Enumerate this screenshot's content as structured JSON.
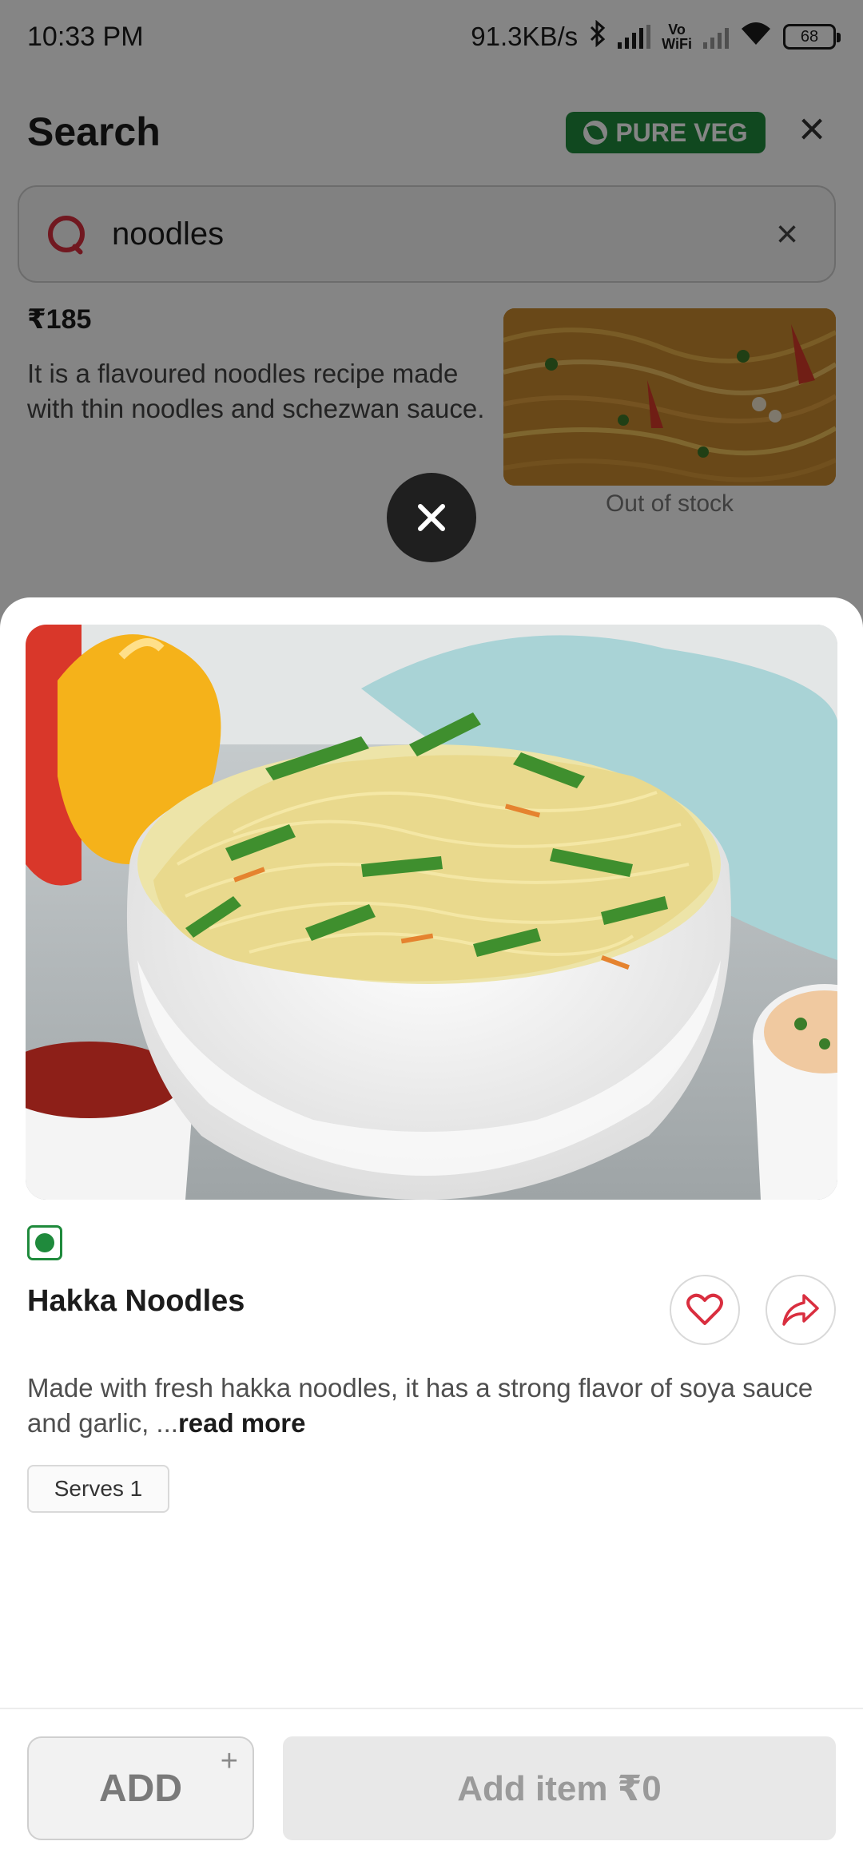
{
  "status_bar": {
    "time": "10:33 PM",
    "network_speed": "91.3KB/s",
    "vowifi_top": "Vo",
    "vowifi_bottom": "WiFi",
    "battery": "68"
  },
  "header": {
    "title": "Search",
    "veg_badge": "PURE VEG"
  },
  "search": {
    "query": "noodles"
  },
  "background_result": {
    "price": "₹185",
    "description": "It is a flavoured noodles recipe made with thin noodles and schezwan sauce.",
    "stock_status": "Out of stock"
  },
  "sheet": {
    "dish_name": "Hakka Noodles",
    "description": "Made with fresh hakka noodles, it has a strong flavor of soya sauce and garlic, ...",
    "read_more": "read more",
    "serves": "Serves 1",
    "add_label": "ADD",
    "add_plus": "+",
    "add_item_label": "Add item ₹0"
  },
  "colors": {
    "brand_red": "#d92e3f",
    "veg_green": "#1f8a3c"
  }
}
